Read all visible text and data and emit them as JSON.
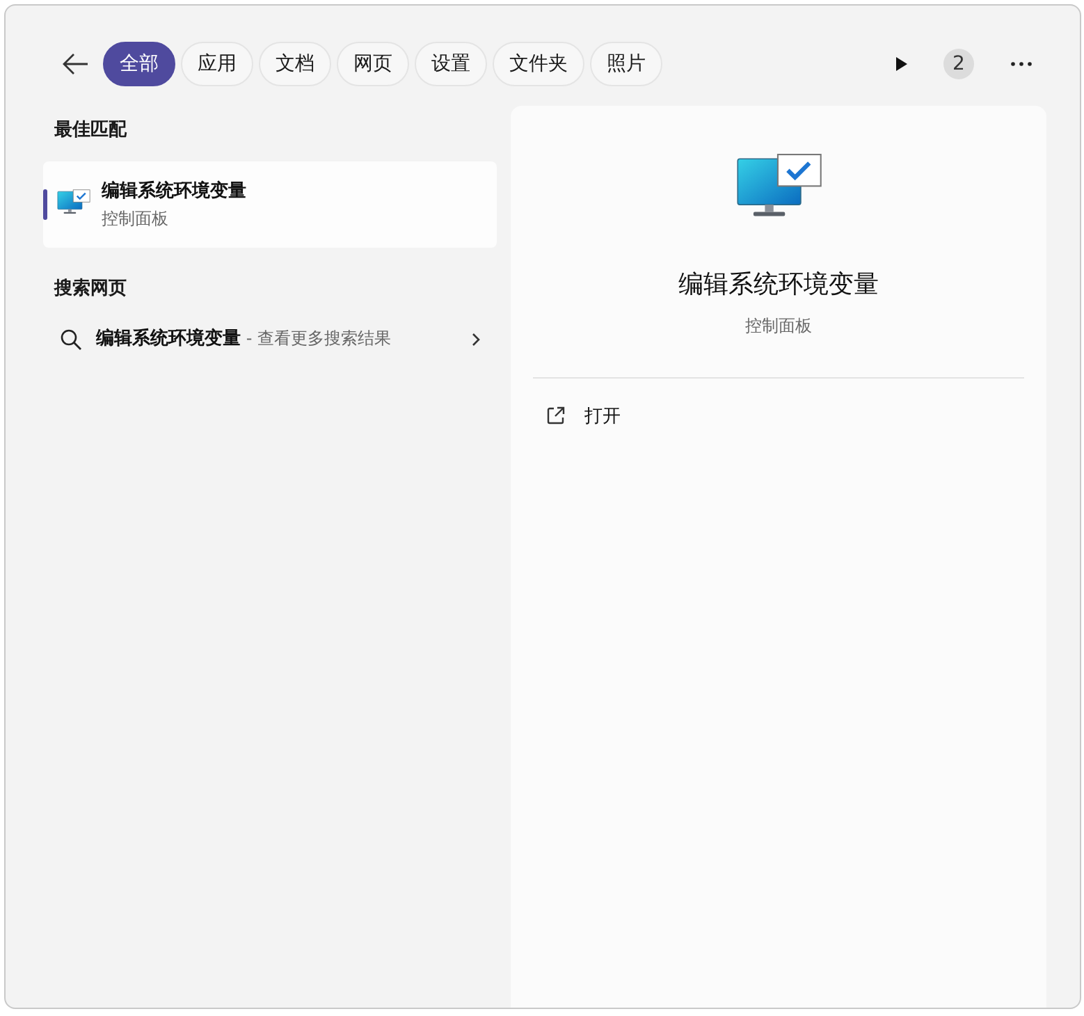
{
  "tabs": [
    {
      "label": "全部",
      "selected": true
    },
    {
      "label": "应用",
      "selected": false
    },
    {
      "label": "文档",
      "selected": false
    },
    {
      "label": "网页",
      "selected": false
    },
    {
      "label": "设置",
      "selected": false
    },
    {
      "label": "文件夹",
      "selected": false
    },
    {
      "label": "照片",
      "selected": false
    }
  ],
  "badge": "2",
  "best_match": {
    "heading": "最佳匹配",
    "items": [
      {
        "title": "编辑系统环境变量",
        "subtitle": "控制面板",
        "selected": true
      }
    ]
  },
  "web_search": {
    "heading": "搜索网页",
    "items": [
      {
        "text": "**编辑系统环境变量** - 查看更多搜索结果"
      }
    ]
  },
  "detail": {
    "title": "编辑系统环境变量",
    "subtitle": "控制面板",
    "actions": [
      {
        "label": "打开"
      }
    ]
  }
}
